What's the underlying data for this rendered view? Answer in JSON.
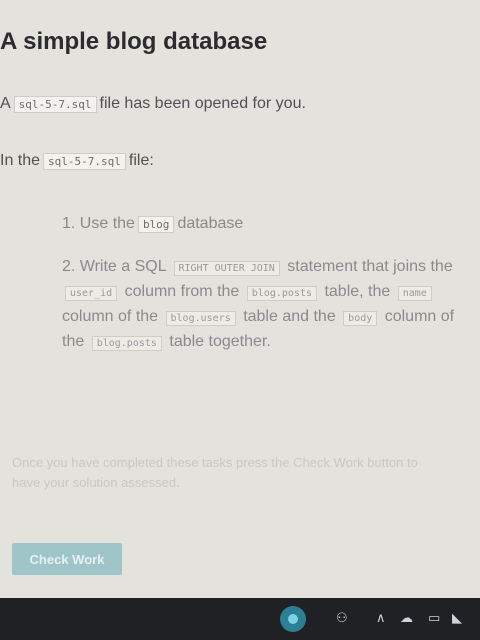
{
  "lesson": {
    "title": "A simple blog database",
    "intro_prefix": "A",
    "intro_file": "sql-5-7.sql",
    "intro_suffix": "file has been opened for you.",
    "in_prefix": "In the",
    "in_file": "sql-5-7.sql",
    "in_suffix": "file:"
  },
  "steps": {
    "step1_text": "1. Use the",
    "step1_db": "blog",
    "step1_suffix": "database",
    "step2_a": "2. Write a SQL",
    "step2_join": "RIGHT OUTER JOIN",
    "step2_b": "statement that joins the",
    "step2_col1": "user_id",
    "step2_c": "column from the",
    "step2_tbl1": "blog.posts",
    "step2_d": "table, the",
    "step2_col2": "name",
    "step2_e": "column of the",
    "step2_tbl2": "blog.users",
    "step2_f": "table and the",
    "step2_col3": "body",
    "step2_g": "column of the",
    "step2_tbl3": "blog.posts",
    "step2_h": "table together."
  },
  "hint": {
    "text": "Once you have completed these tasks press the Check Work button to have your solution assessed."
  },
  "check_button": {
    "label": "Check Work"
  },
  "taskbar": {
    "people_icon": "people-icon",
    "chevron_icon": "chevron-up-icon",
    "cloud_icon": "cloud-icon",
    "battery_icon": "battery-icon",
    "wifi_icon": "wifi-icon"
  }
}
